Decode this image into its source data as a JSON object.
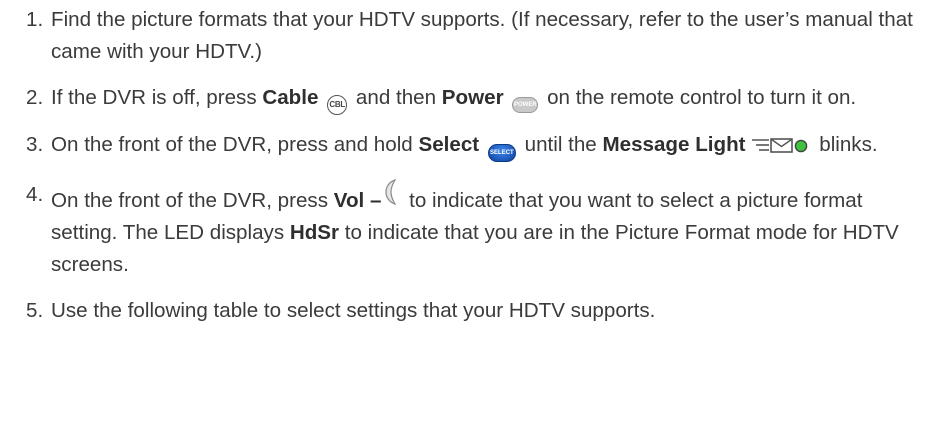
{
  "steps": [
    {
      "num": "1.",
      "t1": "Find the picture formats that your HDTV supports. (If necessary, refer to the user’s manual that came with your HDTV.)"
    },
    {
      "num": "2.",
      "t1": "If the DVR is off, press ",
      "b1": "Cable",
      "icon1": "CBL",
      "t2": " and then ",
      "b2": "Power",
      "icon2": "POWER",
      "t3": " on the remote control to turn it on."
    },
    {
      "num": "3.",
      "t1": "On the front of the DVR, press and hold ",
      "b1": "Select",
      "icon1": "SELECT",
      "t2": " until the ",
      "b2": "Message Light",
      "t3": " blinks."
    },
    {
      "num": "4.",
      "t1": "On the front of the DVR, press ",
      "b1": "Vol –",
      "t2": " to indicate that you want to select a picture format setting. The LED displays ",
      "b2": "HdSr",
      "t3": " to indicate that you are in the Picture Format mode for HDTV screens."
    },
    {
      "num": "5.",
      "t1": "Use the following table to select settings that your HDTV supports."
    }
  ],
  "icons": {
    "cable": "cable-button-icon",
    "power": "power-button-icon",
    "select": "select-button-icon",
    "message": "message-light-icon",
    "vol": "volume-down-button-icon"
  },
  "colors": {
    "text": "#3b3b3b",
    "select_blue": "#1a56b8",
    "message_led": "#3ec23e"
  }
}
